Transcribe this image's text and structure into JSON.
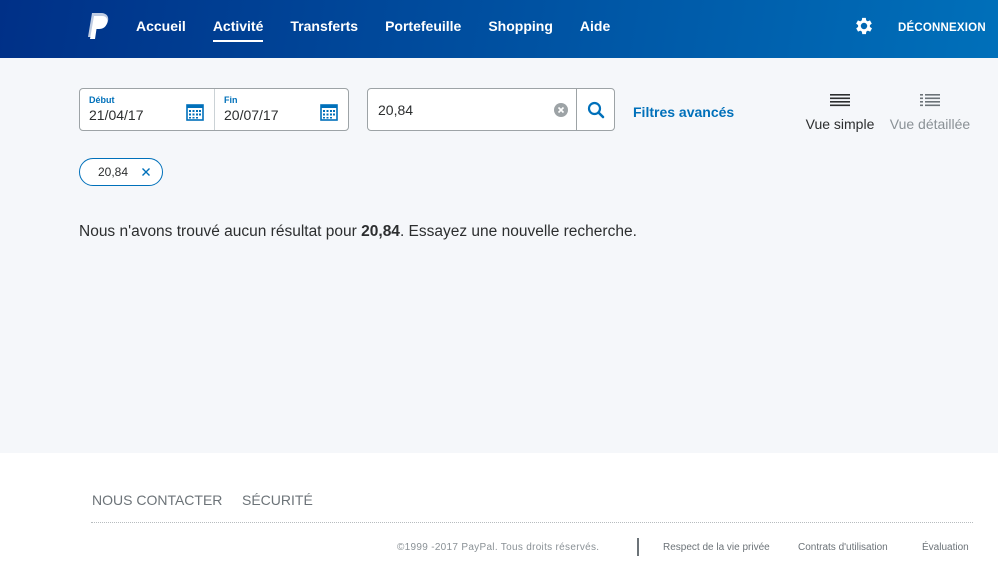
{
  "header": {
    "nav": [
      "Accueil",
      "Activité",
      "Transferts",
      "Portefeuille",
      "Shopping",
      "Aide"
    ],
    "active_nav": "Activité",
    "logout": "DÉCONNEXION"
  },
  "filters": {
    "start_label": "Début",
    "start_value": "21/04/17",
    "end_label": "Fin",
    "end_value": "20/07/17",
    "search_value": "20,84",
    "advanced_filters": "Filtres avancés"
  },
  "views": {
    "simple": "Vue simple",
    "detailed": "Vue détaillée"
  },
  "chip": {
    "label": "20,84"
  },
  "message": {
    "prefix": "Nous n'avons trouvé aucun résultat pour ",
    "term": "20,84",
    "suffix": ". Essayez une nouvelle recherche."
  },
  "footer": {
    "contact": "NOUS CONTACTER",
    "security": "SÉCURITÉ",
    "copyright": "©1999 -2017 PayPal. Tous droits réservés.",
    "privacy": "Respect de la vie privée",
    "terms": "Contrats d'utilisation",
    "feedback": "Évaluation"
  },
  "colors": {
    "brand_dark": "#003087",
    "brand_blue": "#0070ba",
    "background": "#f5f7fa"
  }
}
